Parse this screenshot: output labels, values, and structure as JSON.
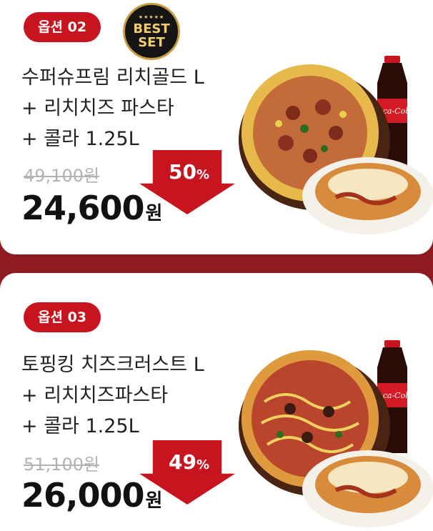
{
  "colors": {
    "accent": "#c8141f",
    "background": "#8e1b22"
  },
  "options": [
    {
      "badge": "옵션 02",
      "best_badge": {
        "line1": "BEST",
        "line2": "SET"
      },
      "title_lines": [
        "수퍼슈프림 리치골드 L",
        "+ 리치치즈 파스타",
        "+ 콜라 1.25L"
      ],
      "original_price": "49,100원",
      "discount_value": "50",
      "discount_symbol": "%",
      "price": "24,600",
      "price_unit": "원",
      "image_icon": "pizza-pasta-cola-image"
    },
    {
      "badge": "옵션 03",
      "title_lines": [
        "토핑킹 치즈크러스트 L",
        "+ 리치치즈파스타",
        "+ 콜라 1.25L"
      ],
      "original_price": "51,100원",
      "discount_value": "49",
      "discount_symbol": "%",
      "price": "26,000",
      "price_unit": "원",
      "image_icon": "pizza-pasta-cola-image"
    }
  ]
}
